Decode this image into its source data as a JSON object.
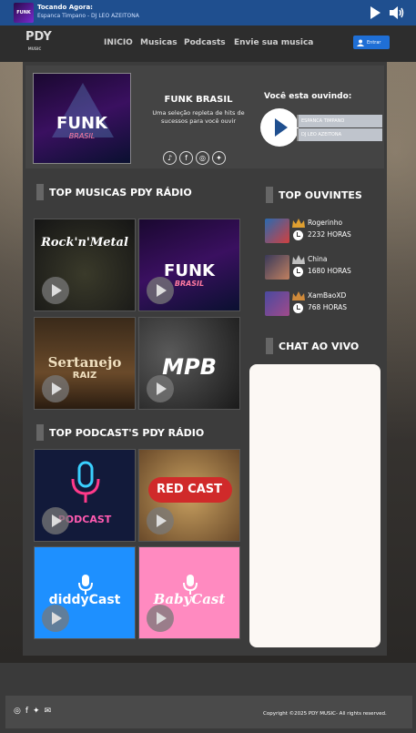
{
  "player": {
    "label": "Tocando Agora:",
    "track": "Espanca Timpano - DJ LEO AZEITONA",
    "thumb_text": "FUNK"
  },
  "nav": {
    "logo_text": "PDY",
    "logo_sub": "MUSIC",
    "items": [
      "INICIO",
      "Musicas",
      "Podcasts",
      "Envie sua musica"
    ],
    "login_label": "Entrar"
  },
  "featured": {
    "art_title": "FUNK",
    "art_subtitle": "BRASIL",
    "title": "FUNK BRASIL",
    "description": "Uma seleção repleta de hits de sucessos para você ouvir",
    "socials": [
      "tiktok-icon",
      "facebook-icon",
      "instagram-icon",
      "twitter-icon"
    ],
    "listening_title": "Você esta ouvindo:",
    "np_song": "ESPANCA TIMPANO",
    "np_artist": "DJ LEO AZEITONA"
  },
  "top_musicas": {
    "title": "TOP MUSICAS PDY RÁDIO",
    "tiles": [
      {
        "label": "Rock'n'Metal"
      },
      {
        "label": "FUNK",
        "sub": "BRASIL"
      },
      {
        "label": "Sertanejo",
        "sub": "RAIZ"
      },
      {
        "label": "MPB"
      }
    ]
  },
  "top_podcasts": {
    "title": "TOP PODCAST'S PDY RÁDIO",
    "tiles": [
      {
        "label": "PODCAST"
      },
      {
        "label": "RED CAST"
      },
      {
        "label": "diddyCast"
      },
      {
        "label": "BabyCast"
      }
    ]
  },
  "top_ouvintes": {
    "title": "TOP OUVINTES",
    "listeners": [
      {
        "name": "Rogerinho",
        "hours": "2232 HORAS",
        "crown": "#e0a030"
      },
      {
        "name": "China",
        "hours": "1680 HORAS",
        "crown": "#c0c0c0"
      },
      {
        "name": "XamBaoXD",
        "hours": "768 HORAS",
        "crown": "#d08a3a"
      }
    ]
  },
  "chat": {
    "title": "CHAT AO VIVO"
  },
  "footer": {
    "icons": [
      "instagram-icon",
      "facebook-icon",
      "twitter-icon",
      "mail-icon"
    ],
    "copyright": "Copyright ©2025 PDY MUSIC- All rights reserved."
  }
}
